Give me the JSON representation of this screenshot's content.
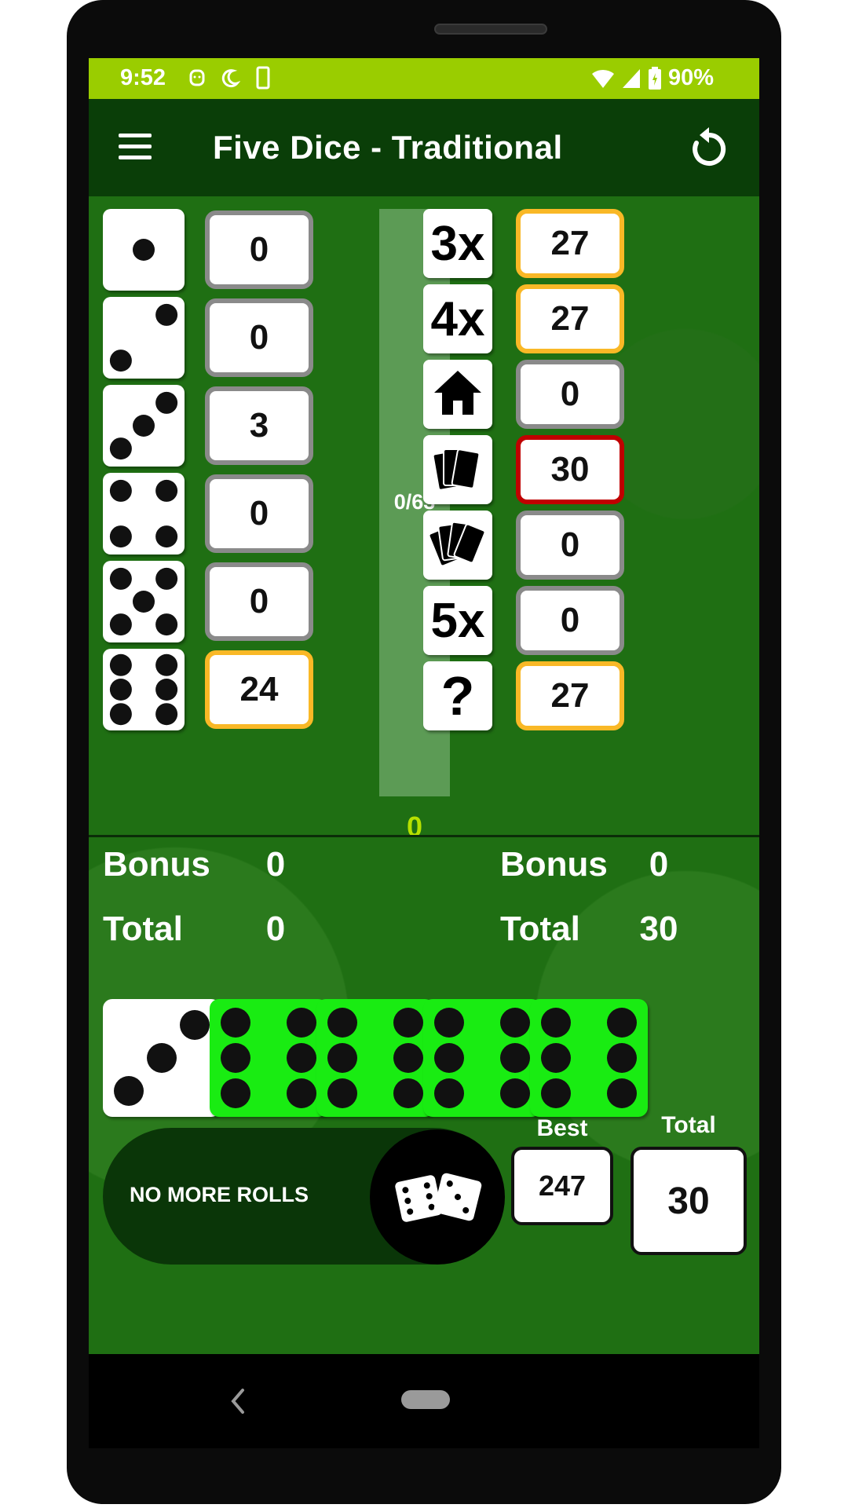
{
  "status_bar": {
    "time": "9:52",
    "battery": "90%"
  },
  "app_bar": {
    "title": "Five Dice - Traditional",
    "menu_icon": "hamburger-menu-icon",
    "reset_icon": "refresh-icon"
  },
  "upper": {
    "rows": [
      {
        "face": 1,
        "score": "0",
        "highlight": "none"
      },
      {
        "face": 2,
        "score": "0",
        "highlight": "none"
      },
      {
        "face": 3,
        "score": "3",
        "highlight": "none"
      },
      {
        "face": 4,
        "score": "0",
        "highlight": "none"
      },
      {
        "face": 5,
        "score": "0",
        "highlight": "none"
      },
      {
        "face": 6,
        "score": "24",
        "highlight": "yellow"
      }
    ],
    "progress_label": "0/63",
    "progress_value": "0",
    "bonus_label": "Bonus",
    "bonus": "0",
    "total_label": "Total",
    "total": "0"
  },
  "lower": {
    "rows": [
      {
        "category": "3x",
        "icon": "text",
        "score": "27",
        "highlight": "yellow"
      },
      {
        "category": "4x",
        "icon": "text",
        "score": "27",
        "highlight": "yellow"
      },
      {
        "category": "",
        "icon": "house-icon",
        "score": "0",
        "highlight": "none"
      },
      {
        "category": "",
        "icon": "small-straight-cards-icon",
        "score": "30",
        "highlight": "red"
      },
      {
        "category": "",
        "icon": "large-straight-cards-icon",
        "score": "0",
        "highlight": "none"
      },
      {
        "category": "5x",
        "icon": "text",
        "score": "0",
        "highlight": "none"
      },
      {
        "category": "?",
        "icon": "text",
        "score": "27",
        "highlight": "yellow"
      }
    ],
    "bonus_label": "Bonus",
    "bonus": "0",
    "total_label": "Total",
    "total": "30"
  },
  "rolled_dice": [
    {
      "face": 3,
      "held": false
    },
    {
      "face": 6,
      "held": true
    },
    {
      "face": 6,
      "held": true
    },
    {
      "face": 6,
      "held": true
    },
    {
      "face": 6,
      "held": true
    }
  ],
  "footer": {
    "roll_status": "NO MORE ROLLS",
    "roll_button_icon": "roll-dice-icon",
    "best_label": "Best",
    "best": "247",
    "total_label": "Total",
    "total": "30"
  },
  "colors": {
    "status_bar": "#9acd00",
    "app_bar": "#0a3e08",
    "felt": "#1f6f13",
    "held_die": "#19ec12",
    "highlight_yellow": "#f9b826",
    "highlight_red": "#c00000"
  }
}
